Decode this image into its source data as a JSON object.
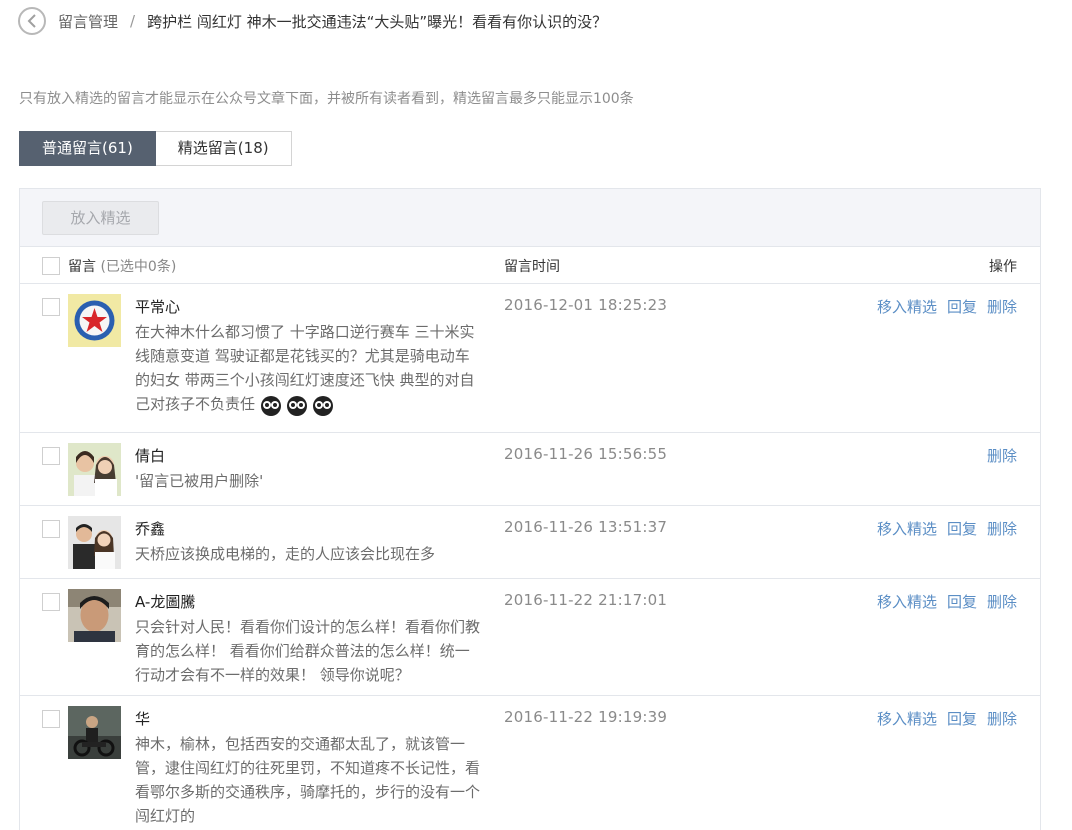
{
  "breadcrumb": {
    "parent": "留言管理",
    "separator": "/",
    "title": "跨护栏 闯红灯 神木一批交通违法“大头贴”曝光！看看有你认识的没？"
  },
  "notice": "只有放入精选的留言才能显示在公众号文章下面，并被所有读者看到，精选留言最多只能显示100条",
  "tabs": [
    {
      "label": "普通留言(61)",
      "active": true
    },
    {
      "label": "精选留言(18)",
      "active": false
    }
  ],
  "toolbar": {
    "select_button": "放入精选"
  },
  "table": {
    "col_message": "留言",
    "col_message_sub": "(已选中0条)",
    "col_time": "留言时间",
    "col_ops": "操作"
  },
  "ops_labels": {
    "feature": "移入精选",
    "reply": "回复",
    "delete": "删除"
  },
  "rows": [
    {
      "name": "平常心",
      "content": "在大神木什么都习惯了 十字路口逆行赛车 三十米实线随意变道 驾驶证都是花钱买的？尤其是骑电动车的妇女 带两三个小孩闯红灯速度还飞快 典型的对自己对孩子不负责任",
      "time": "2016-12-01 18:25:23",
      "emoji_count": 3,
      "ops": [
        "feature",
        "reply",
        "delete"
      ]
    },
    {
      "name": "倩白",
      "content": "'留言已被用户删除'",
      "time": "2016-11-26 15:56:55",
      "ops": [
        "delete"
      ]
    },
    {
      "name": "乔鑫",
      "content": "天桥应该换成电梯的，走的人应该会比现在多",
      "time": "2016-11-26 13:51:37",
      "ops": [
        "feature",
        "reply",
        "delete"
      ]
    },
    {
      "name": "A-龙圖騰",
      "content": "只会针对人民！看看你们设计的怎么样！看看你们教育的怎么样！ 看看你们给群众普法的怎么样！统一行动才会有不一样的效果！ 领导你说呢？",
      "time": "2016-11-22 21:17:01",
      "ops": [
        "feature",
        "reply",
        "delete"
      ]
    },
    {
      "name": "华",
      "content": "神木，榆林，包括西安的交通都太乱了，就该管一管，逮住闯红灯的往死里罚，不知道疼不长记性，看看鄂尔多斯的交通秩序，骑摩托的，步行的没有一个闯红灯的",
      "time": "2016-11-22 19:19:39",
      "ops": [
        "feature",
        "reply",
        "delete"
      ]
    }
  ]
}
